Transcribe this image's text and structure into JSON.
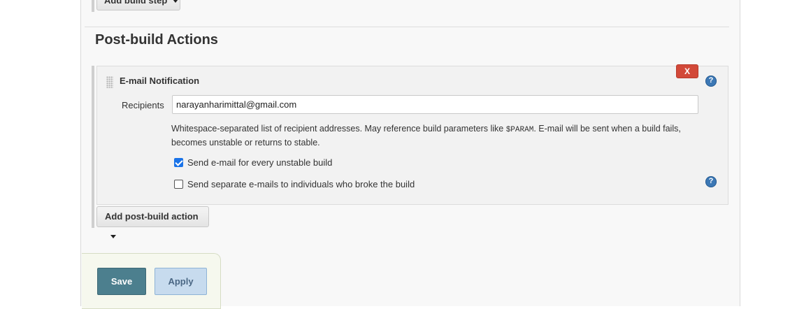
{
  "build_steps": {
    "add_button_label": "Add build step"
  },
  "post_build": {
    "section_title": "Post-build Actions",
    "email_notification": {
      "title": "E-mail Notification",
      "delete_label": "X",
      "help_icon": "?",
      "recipients_label": "Recipients",
      "recipients_value": "narayanharimittal@gmail.com",
      "help_text_before": "Whitespace-separated list of recipient addresses. May reference build parameters like ",
      "help_text_code": "$PARAM",
      "help_text_after": ". E-mail will be sent when a build fails, becomes unstable or returns to stable.",
      "options": [
        {
          "label": "Send e-mail for every unstable build",
          "checked": true
        },
        {
          "label": "Send separate e-mails to individuals who broke the build",
          "checked": false
        }
      ]
    },
    "add_action_label": "Add post-build action"
  },
  "actions": {
    "save_label": "Save",
    "apply_label": "Apply"
  },
  "colors": {
    "delete": "#d24939",
    "help": "#3c78b5",
    "save": "#4c7f8e",
    "apply": "#c7dbee",
    "checkbox": "#1a73e8"
  }
}
